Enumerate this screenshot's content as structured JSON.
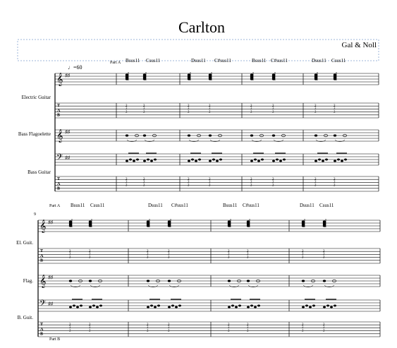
{
  "score": {
    "title": "Carlton",
    "composer": "Gal & Noll",
    "tempo_marking": "♩=60",
    "measure_number_system2": "9"
  },
  "system1": {
    "instruments": [
      "Electric Guitar",
      "Bass Flagoelette",
      "Bass Guitar"
    ],
    "section_label": "Part A",
    "chords": [
      "Bsus11",
      "Csus11",
      "Dsus11",
      "C#sus11",
      "Bsus11",
      "C#sus11",
      "Dsus11",
      "Csus11"
    ]
  },
  "system2": {
    "instruments": [
      "El. Guit.",
      "Flag.",
      "B. Guit."
    ],
    "section_label": "Part A",
    "section_label_bottom": "Part B",
    "chords": [
      "Bsus11",
      "Csus11",
      "Dsus11",
      "C#sus11",
      "Bsus11",
      "C#sus11",
      "Dsus11",
      "Csus11"
    ]
  }
}
